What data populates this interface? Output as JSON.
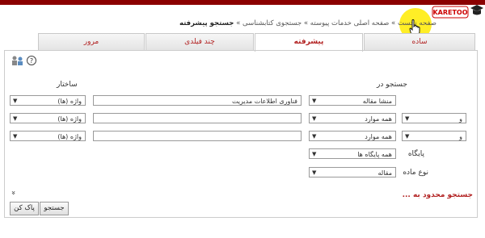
{
  "header": {
    "logo_text": "KARETOO"
  },
  "breadcrumb": {
    "items": [
      "صفحه نخست",
      "صفحه اصلی خدمات پیوسته",
      "جستجوی کتابشناسی"
    ],
    "separator": "»",
    "current": "جستجو پیشرفته"
  },
  "tabs": [
    {
      "label": "ساده"
    },
    {
      "label": "پیشرفته"
    },
    {
      "label": "چند فیلدی"
    },
    {
      "label": "مرور"
    }
  ],
  "labels": {
    "search_in": "جستجو در",
    "structure": "ساختار",
    "database": "پایگاه",
    "material_type": "نوع ماده",
    "restrict": "جستجو محدود به ..."
  },
  "rows": [
    {
      "operator": "",
      "field": "منشا مقاله",
      "term": "فناوری اطلاعات مدیریت",
      "structure": "واژه (ها)"
    },
    {
      "operator": "و",
      "field": "همه موارد",
      "term": "",
      "structure": "واژه (ها)"
    },
    {
      "operator": "و",
      "field": "همه موارد",
      "term": "",
      "structure": "واژه (ها)"
    }
  ],
  "database_value": "همه پایگاه ها",
  "material_value": "مقاله",
  "buttons": {
    "search": "جستجو",
    "clear": "پاک کن"
  },
  "expand_symbol": "»",
  "colors": {
    "topbar": "#8b0000",
    "tab_text": "#b22222",
    "highlight": "#ffeb00"
  }
}
